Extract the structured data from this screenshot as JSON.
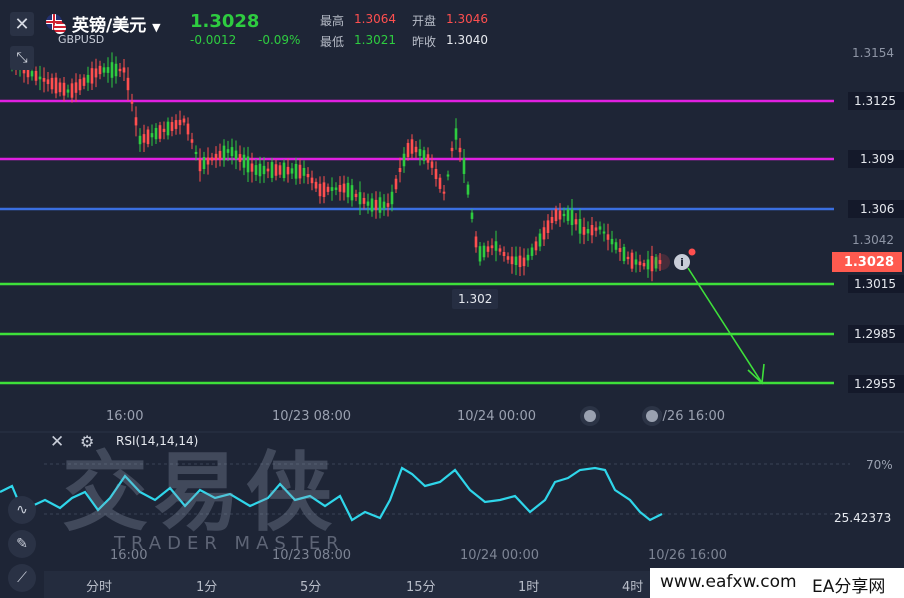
{
  "header": {
    "pair_name": "英镑/美元",
    "symbol": "GBPUSD",
    "price": "1.3028",
    "change": "-0.0012",
    "change_pct": "-0.09%",
    "high_label": "最高",
    "high_value": "1.3064",
    "open_label": "开盘",
    "open_value": "1.3046",
    "low_label": "最低",
    "low_value": "1.3021",
    "prev_label": "昨收",
    "prev_value": "1.3040"
  },
  "price_axis": {
    "top": "1.3154",
    "mid": "1.3042",
    "current": "1.3028"
  },
  "levels": [
    {
      "value": "1.3125",
      "color": "#e020e0"
    },
    {
      "value": "1.309",
      "color": "#e020e0"
    },
    {
      "value": "1.306",
      "color": "#3a6fe0"
    },
    {
      "value": "1.3015",
      "color": "#3ee03a"
    },
    {
      "value": "1.2985",
      "color": "#3ee03a"
    },
    {
      "value": "1.2955",
      "color": "#3ee03a"
    }
  ],
  "low_callout": "1.302",
  "time_labels": [
    "16:00",
    "10/23 08:00",
    "10/24 00:00",
    "10/26 16:00"
  ],
  "rsi": {
    "name": "RSI(14,14,14)",
    "level_70": "70%",
    "value": "25.42373"
  },
  "watermark": {
    "main": "交易侠",
    "sub": "TRADER MASTER"
  },
  "timeframes": [
    "分时",
    "1分",
    "5分",
    "15分",
    "1时",
    "4时"
  ],
  "footer": {
    "site": "www.eafxw.com",
    "brand": "EA分享网"
  },
  "colors": {
    "up": "#2ecc40",
    "down": "#ff4f4f",
    "bg": "#1e2536",
    "rsi_line": "#2fd6ea"
  },
  "icons": {
    "close": "close-icon",
    "collapse": "collapse-icon",
    "settings": "settings-icon",
    "info": "info-icon"
  }
}
